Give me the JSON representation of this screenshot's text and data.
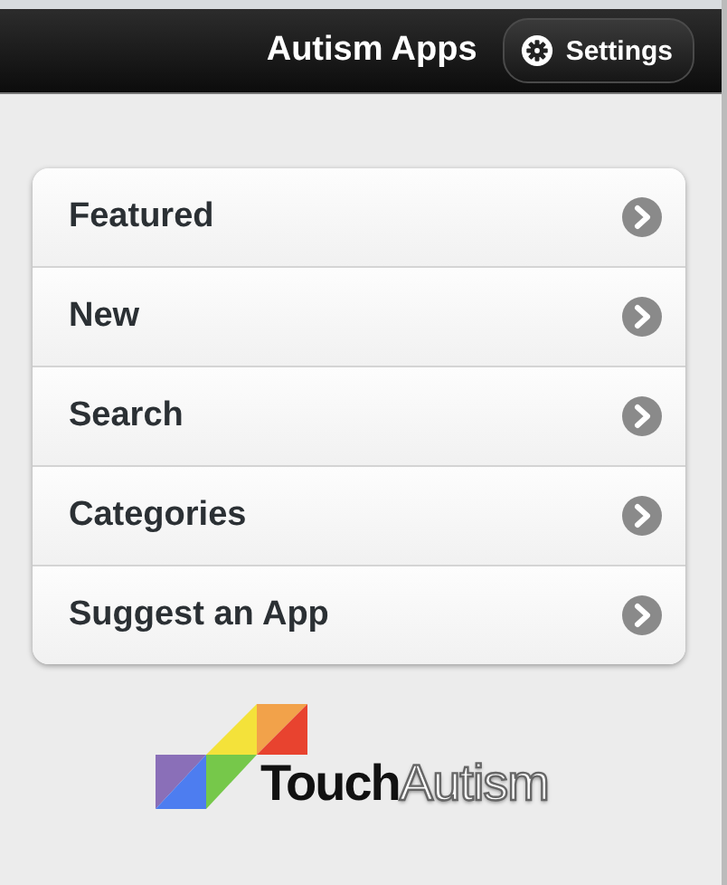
{
  "header": {
    "title": "Autism Apps",
    "settings_button": "Settings"
  },
  "menu": [
    {
      "label": "Featured"
    },
    {
      "label": "New"
    },
    {
      "label": "Search"
    },
    {
      "label": "Categories"
    },
    {
      "label": "Suggest an App"
    }
  ],
  "logo": {
    "word_1": "Touch",
    "word_2": "Autism"
  }
}
